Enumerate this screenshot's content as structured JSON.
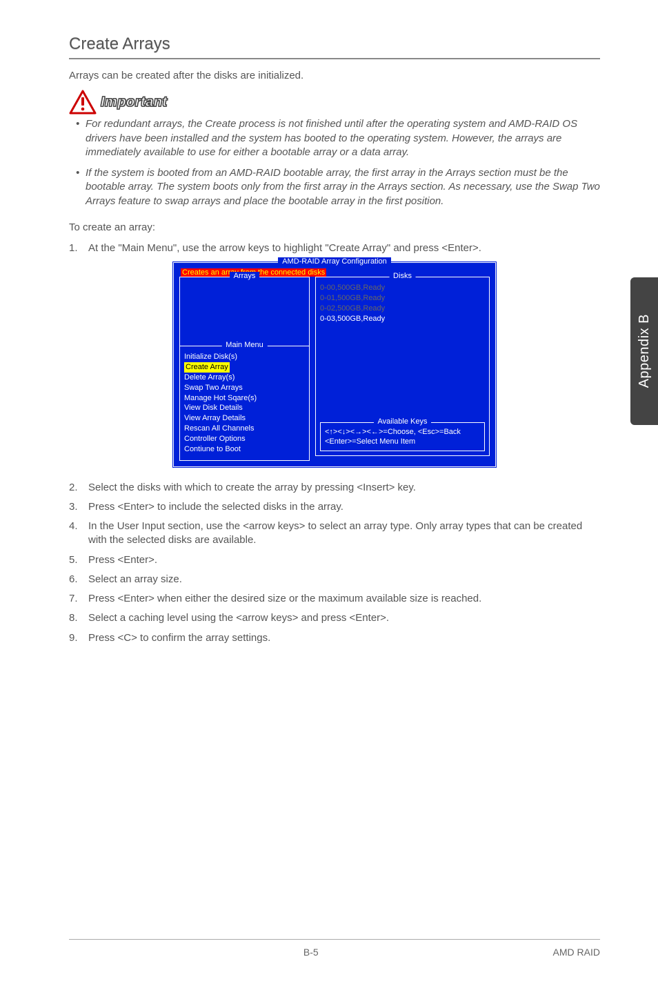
{
  "heading": "Create Arrays",
  "intro": "Arrays can be created after the disks are initialized.",
  "important_label": "Important",
  "important_bullets": [
    "For redundant arrays, the Create process is not finished until after the operating system and AMD-RAID OS drivers have been installed and the system has booted to the operating system. However, the arrays are immediately available to use for either a bootable array or a data array.",
    "If the system is booted from an AMD-RAID bootable array, the first array in the Arrays section must be the bootable array. The system boots only from the first array in the Arrays section. As necessary, use the Swap Two Arrays feature to swap arrays and place the bootable array in the first position."
  ],
  "to_create": "To create an array:",
  "step1": "At the \"Main Menu\", use the arrow keys to highlight \"Create Array\" and press <Enter>.",
  "bios": {
    "title": "AMD-RAID Array Configuration",
    "status": "Creates an array from the connected disks",
    "arrays_label": "Arrays",
    "disks_label": "Disks",
    "disks": [
      {
        "text": "0-00,500GB,Ready",
        "active": false
      },
      {
        "text": "0-01,500GB,Ready",
        "active": false
      },
      {
        "text": "0-02,500GB,Ready",
        "active": false
      },
      {
        "text": "0-03,500GB,Ready",
        "active": true
      }
    ],
    "main_menu_label": "Main Menu",
    "menu_items": [
      {
        "text": "Initialize Disk(s)",
        "hl": false
      },
      {
        "text": "Create Array",
        "hl": true
      },
      {
        "text": "Delete Array(s)",
        "hl": false
      },
      {
        "text": "Swap Two Arrays",
        "hl": false
      },
      {
        "text": "Manage Hot Sqare(s)",
        "hl": false
      },
      {
        "text": "View Disk Details",
        "hl": false
      },
      {
        "text": "View Array Details",
        "hl": false
      },
      {
        "text": "Rescan All Channels",
        "hl": false
      },
      {
        "text": "Controller Options",
        "hl": false
      },
      {
        "text": "Contiune to Boot",
        "hl": false
      }
    ],
    "avail_label": "Available Keys",
    "avail_line1": "<↑><↓><→><←>=Choose, <Esc>=Back",
    "avail_line2": "<Enter>=Select Menu Item"
  },
  "steps_rest": [
    "Select the disks with which to create the array by pressing <Insert> key.",
    "Press <Enter> to include the selected disks in the array.",
    "In the User Input section, use the <arrow keys> to select an array type. Only array types that can be created with the selected disks are available.",
    "Press <Enter>.",
    "Select an array size.",
    "Press <Enter> when either the desired size or the maximum available size is reached.",
    "Select a caching level using the <arrow keys> and press <Enter>.",
    "Press <C> to confirm the array settings."
  ],
  "side_tab": "Appendix B",
  "footer_page": "B-5",
  "footer_right": "AMD RAID"
}
